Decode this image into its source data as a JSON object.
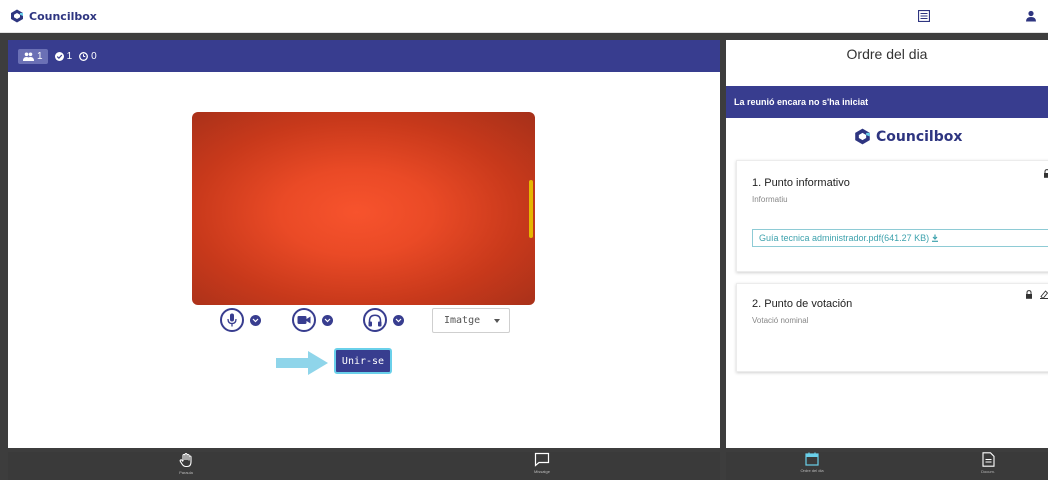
{
  "header": {
    "app_name": "Councilbox",
    "icons": [
      "list-icon",
      "user-icon"
    ]
  },
  "left": {
    "stats": {
      "participants": "1",
      "online": "1",
      "connected": "0"
    },
    "mic_icon": "microphone-icon",
    "cam_icon": "camera-icon",
    "audio_icon": "headphones-icon",
    "view_select": "Imatge",
    "join_label": "Unir-se"
  },
  "right": {
    "title": "Ordre del dia",
    "status": "La reunió encara no s'ha iniciat",
    "brand": "Councilbox",
    "items": [
      {
        "title": "1. Punto informativo",
        "subtitle": "Informatiu",
        "attachment": "Guía tecnica administrador.pdf(641.27 KB)"
      },
      {
        "title": "2. Punto de votación",
        "subtitle": "Votació nominal"
      }
    ]
  },
  "bottom": {
    "left_items": [
      {
        "icon": "hand-icon",
        "label": "Paraula"
      },
      {
        "icon": "chat-icon",
        "label": "Missatge"
      }
    ],
    "right_items": [
      {
        "icon": "calendar-icon",
        "label": "Ordre del dia"
      },
      {
        "icon": "document-icon",
        "label": "Docum."
      }
    ]
  },
  "colors": {
    "primary": "#383d8f",
    "accent": "#6ad0ea",
    "link": "#3ea2ad",
    "volume": "#e6b800"
  }
}
